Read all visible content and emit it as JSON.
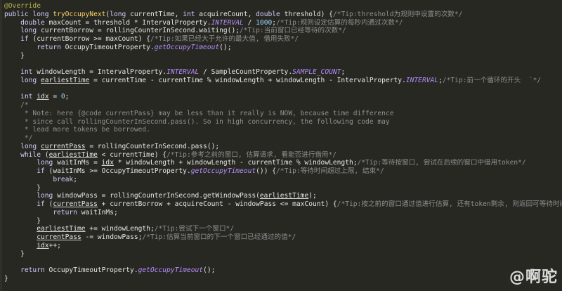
{
  "editor": {
    "lines": [
      "@Override",
      "public long tryOccupyNext(long currentTime, int acquireCount, double threshold) {/*Tip:threshold为规则中设置的次数*/",
      "    double maxCount = threshold * IntervalProperty.INTERVAL / 1000;/*Tip:规则设定估算的每秒内通过次数*/",
      "    long currentBorrow = rollingCounterInSecond.waiting();/*Tip:当前窗口已经等待的次数*/",
      "    if (currentBorrow >= maxCount) {/*Tip:如果已经大于允许的最大值, 借用失败*/",
      "        return OccupyTimeoutProperty.getOccupyTimeout();",
      "    }",
      "",
      "    int windowLength = IntervalProperty.INTERVAL / SampleCountProperty.SAMPLE_COUNT;",
      "    long earliestTime = currentTime - currentTime % windowLength + windowLength - IntervalProperty.INTERVAL;/*Tip:前一个循环的开头  `*/",
      "",
      "    int idx = 0;",
      "    /*",
      "     * Note: here {@code currentPass} may be less than it really is NOW, because time difference",
      "     * since call rollingCounterInSecond.pass(). So in high concurrency, the following code may",
      "     * lead more tokens be borrowed.",
      "     */",
      "    long currentPass = rollingCounterInSecond.pass();",
      "    while (earliestTime < currentTime) {/*Tip:参考之前的窗口, 估算请求, 看能否进行借用*/",
      "        long waitInMs = idx * windowLength + windowLength - currentTime % windowLength;/*Tip:等待按窗口, 尝试在后续的窗口中借用token*/",
      "        if (waitInMs >= OccupyTimeoutProperty.getOccupyTimeout()) {/*Tip:等待时间超过上限, 结束*/",
      "            break;",
      "        }",
      "        long windowPass = rollingCounterInSecond.getWindowPass(earliestTime);",
      "        if (currentPass + currentBorrow + acquireCount - windowPass <= maxCount) {/*Tip:按之前的窗口通过值进行估算, 还有token剩余, 则返回可等待时间*/",
      "            return waitInMs;",
      "        }",
      "        earliestTime += windowLength;/*Tip:尝试下一个窗口*/",
      "        currentPass -= windowPass;/*Tip:估算当前窗口的下一个窗口已经通过的值*/",
      "        idx++;",
      "    }",
      "",
      "    return OccupyTimeoutProperty.getOccupyTimeout();",
      "}"
    ]
  },
  "watermark": "@啊驼",
  "colors": {
    "background": "#272822",
    "keyword": "#d6ccff",
    "method": "#ffd56a",
    "comment": "#8f8f8f",
    "static_field": "#b78cff",
    "annotation": "#b7b04a"
  }
}
